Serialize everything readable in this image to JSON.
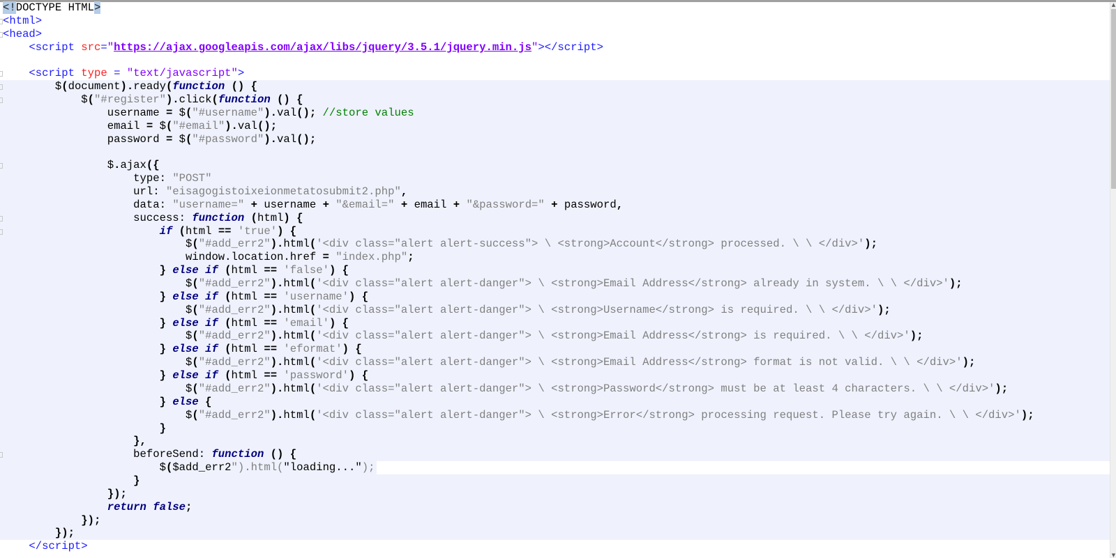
{
  "editor": {
    "lines": [
      {
        "bg": "",
        "fold": false,
        "tokens": [
          [
            "sel",
            "<!"
          ],
          [
            "d",
            "DOCTYPE HTML"
          ],
          [
            "sel",
            ">"
          ]
        ]
      },
      {
        "bg": "",
        "fold": true,
        "tokens": [
          [
            "t",
            "<html>"
          ]
        ]
      },
      {
        "bg": "",
        "fold": true,
        "tokens": [
          [
            "t",
            "<head>"
          ]
        ]
      },
      {
        "bg": "",
        "fold": false,
        "tokens": [
          [
            "t",
            "    <script "
          ],
          [
            "a",
            "src"
          ],
          [
            "t",
            "="
          ],
          [
            "s",
            "\""
          ],
          [
            "u",
            "https://ajax.googleapis.com/ajax/libs/jquery/3.5.1/jquery.min.js"
          ],
          [
            "s",
            "\""
          ],
          [
            "t",
            "></script>"
          ]
        ]
      },
      {
        "bg": "",
        "fold": false,
        "tokens": []
      },
      {
        "bg": "",
        "fold": true,
        "tokens": [
          [
            "t",
            "    <script "
          ],
          [
            "a",
            "type"
          ],
          [
            "t",
            " = "
          ],
          [
            "s",
            "\"text/javascript\""
          ],
          [
            "t",
            ">"
          ]
        ]
      },
      {
        "bg": "js",
        "fold": true,
        "tokens": [
          [
            "d",
            "        $"
          ],
          [
            "o",
            "("
          ],
          [
            "d",
            "document"
          ],
          [
            "o",
            ")."
          ],
          [
            "d",
            "ready"
          ],
          [
            "o",
            "("
          ],
          [
            "k",
            "function"
          ],
          [
            "o",
            " () {"
          ]
        ]
      },
      {
        "bg": "js",
        "fold": true,
        "tokens": [
          [
            "d",
            "            $"
          ],
          [
            "o",
            "("
          ],
          [
            "g",
            "\"#register\""
          ],
          [
            "o",
            ")."
          ],
          [
            "d",
            "click"
          ],
          [
            "o",
            "("
          ],
          [
            "k",
            "function"
          ],
          [
            "o",
            " () {"
          ]
        ]
      },
      {
        "bg": "js",
        "fold": false,
        "tokens": [
          [
            "d",
            "                username "
          ],
          [
            "o",
            "="
          ],
          [
            "d",
            " $"
          ],
          [
            "o",
            "("
          ],
          [
            "g",
            "\"#username\""
          ],
          [
            "o",
            ")."
          ],
          [
            "d",
            "val"
          ],
          [
            "o",
            "();"
          ],
          [
            "c",
            " //store values"
          ]
        ]
      },
      {
        "bg": "js",
        "fold": false,
        "tokens": [
          [
            "d",
            "                email "
          ],
          [
            "o",
            "="
          ],
          [
            "d",
            " $"
          ],
          [
            "o",
            "("
          ],
          [
            "g",
            "\"#email\""
          ],
          [
            "o",
            ")."
          ],
          [
            "d",
            "val"
          ],
          [
            "o",
            "();"
          ]
        ]
      },
      {
        "bg": "js",
        "fold": false,
        "tokens": [
          [
            "d",
            "                password "
          ],
          [
            "o",
            "="
          ],
          [
            "d",
            " $"
          ],
          [
            "o",
            "("
          ],
          [
            "g",
            "\"#password\""
          ],
          [
            "o",
            ")."
          ],
          [
            "d",
            "val"
          ],
          [
            "o",
            "();"
          ]
        ]
      },
      {
        "bg": "js",
        "fold": false,
        "tokens": []
      },
      {
        "bg": "js",
        "fold": true,
        "tokens": [
          [
            "d",
            "                $"
          ],
          [
            "o",
            "."
          ],
          [
            "d",
            "ajax"
          ],
          [
            "o",
            "({"
          ]
        ]
      },
      {
        "bg": "js",
        "fold": false,
        "tokens": [
          [
            "d",
            "                    type: "
          ],
          [
            "g",
            "\"POST\""
          ]
        ]
      },
      {
        "bg": "js",
        "fold": false,
        "tokens": [
          [
            "d",
            "                    url: "
          ],
          [
            "g",
            "\"eisagogistoixeionmetatosubmit2.php\""
          ],
          [
            "o",
            ","
          ]
        ]
      },
      {
        "bg": "js",
        "fold": false,
        "tokens": [
          [
            "d",
            "                    data: "
          ],
          [
            "g",
            "\"username=\""
          ],
          [
            "o",
            " + "
          ],
          [
            "d",
            "username "
          ],
          [
            "o",
            "+"
          ],
          [
            "d",
            " "
          ],
          [
            "g",
            "\"&email=\""
          ],
          [
            "o",
            " + "
          ],
          [
            "d",
            "email "
          ],
          [
            "o",
            "+"
          ],
          [
            "d",
            " "
          ],
          [
            "g",
            "\"&password=\""
          ],
          [
            "o",
            " + "
          ],
          [
            "d",
            "password"
          ],
          [
            "o",
            ","
          ]
        ]
      },
      {
        "bg": "js",
        "fold": true,
        "tokens": [
          [
            "d",
            "                    success: "
          ],
          [
            "k",
            "function"
          ],
          [
            "o",
            " ("
          ],
          [
            "d",
            "html"
          ],
          [
            "o",
            ") {"
          ]
        ]
      },
      {
        "bg": "js",
        "fold": true,
        "tokens": [
          [
            "d",
            "                        "
          ],
          [
            "k",
            "if"
          ],
          [
            "o",
            " ("
          ],
          [
            "d",
            "html "
          ],
          [
            "o",
            "=="
          ],
          [
            "d",
            " "
          ],
          [
            "g",
            "'true'"
          ],
          [
            "o",
            ") {"
          ]
        ]
      },
      {
        "bg": "js",
        "fold": false,
        "tokens": [
          [
            "d",
            "                            $"
          ],
          [
            "o",
            "("
          ],
          [
            "g",
            "\"#add_err2\""
          ],
          [
            "o",
            ")."
          ],
          [
            "d",
            "html"
          ],
          [
            "o",
            "("
          ],
          [
            "g",
            "'<div class=\"alert alert-success\"> \\ <strong>Account</strong> processed. \\ \\ </div>'"
          ],
          [
            "o",
            ");"
          ]
        ]
      },
      {
        "bg": "js",
        "fold": false,
        "tokens": [
          [
            "d",
            "                            window.location.href "
          ],
          [
            "o",
            "="
          ],
          [
            "d",
            " "
          ],
          [
            "g",
            "\"index.php\""
          ],
          [
            "o",
            ";"
          ]
        ]
      },
      {
        "bg": "js",
        "fold": false,
        "tokens": [
          [
            "o",
            "                        } "
          ],
          [
            "k",
            "else if"
          ],
          [
            "o",
            " ("
          ],
          [
            "d",
            "html "
          ],
          [
            "o",
            "=="
          ],
          [
            "d",
            " "
          ],
          [
            "g",
            "'false'"
          ],
          [
            "o",
            ") {"
          ]
        ]
      },
      {
        "bg": "js",
        "fold": false,
        "tokens": [
          [
            "d",
            "                            $"
          ],
          [
            "o",
            "("
          ],
          [
            "g",
            "\"#add_err2\""
          ],
          [
            "o",
            ")."
          ],
          [
            "d",
            "html"
          ],
          [
            "o",
            "("
          ],
          [
            "g",
            "'<div class=\"alert alert-danger\"> \\ <strong>Email Address</strong> already in system. \\ \\ </div>'"
          ],
          [
            "o",
            ");"
          ]
        ]
      },
      {
        "bg": "js",
        "fold": false,
        "tokens": [
          [
            "o",
            "                        } "
          ],
          [
            "k",
            "else if"
          ],
          [
            "o",
            " ("
          ],
          [
            "d",
            "html "
          ],
          [
            "o",
            "=="
          ],
          [
            "d",
            " "
          ],
          [
            "g",
            "'username'"
          ],
          [
            "o",
            ") {"
          ]
        ]
      },
      {
        "bg": "js",
        "fold": false,
        "tokens": [
          [
            "d",
            "                            $"
          ],
          [
            "o",
            "("
          ],
          [
            "g",
            "\"#add_err2\""
          ],
          [
            "o",
            ")."
          ],
          [
            "d",
            "html"
          ],
          [
            "o",
            "("
          ],
          [
            "g",
            "'<div class=\"alert alert-danger\"> \\ <strong>Username</strong> is required. \\ \\ </div>'"
          ],
          [
            "o",
            ");"
          ]
        ]
      },
      {
        "bg": "js",
        "fold": false,
        "tokens": [
          [
            "o",
            "                        } "
          ],
          [
            "k",
            "else if"
          ],
          [
            "o",
            " ("
          ],
          [
            "d",
            "html "
          ],
          [
            "o",
            "=="
          ],
          [
            "d",
            " "
          ],
          [
            "g",
            "'email'"
          ],
          [
            "o",
            ") {"
          ]
        ]
      },
      {
        "bg": "js",
        "fold": false,
        "tokens": [
          [
            "d",
            "                            $"
          ],
          [
            "o",
            "("
          ],
          [
            "g",
            "\"#add_err2\""
          ],
          [
            "o",
            ")."
          ],
          [
            "d",
            "html"
          ],
          [
            "o",
            "("
          ],
          [
            "g",
            "'<div class=\"alert alert-danger\"> \\ <strong>Email Address</strong> is required. \\ \\ </div>'"
          ],
          [
            "o",
            ");"
          ]
        ]
      },
      {
        "bg": "js",
        "fold": false,
        "tokens": [
          [
            "o",
            "                        } "
          ],
          [
            "k",
            "else if"
          ],
          [
            "o",
            " ("
          ],
          [
            "d",
            "html "
          ],
          [
            "o",
            "=="
          ],
          [
            "d",
            " "
          ],
          [
            "g",
            "'eformat'"
          ],
          [
            "o",
            ") {"
          ]
        ]
      },
      {
        "bg": "js",
        "fold": false,
        "tokens": [
          [
            "d",
            "                            $"
          ],
          [
            "o",
            "("
          ],
          [
            "g",
            "\"#add_err2\""
          ],
          [
            "o",
            ")."
          ],
          [
            "d",
            "html"
          ],
          [
            "o",
            "("
          ],
          [
            "g",
            "'<div class=\"alert alert-danger\"> \\ <strong>Email Address</strong> format is not valid. \\ \\ </div>'"
          ],
          [
            "o",
            ");"
          ]
        ]
      },
      {
        "bg": "js",
        "fold": false,
        "tokens": [
          [
            "o",
            "                        } "
          ],
          [
            "k",
            "else if"
          ],
          [
            "o",
            " ("
          ],
          [
            "d",
            "html "
          ],
          [
            "o",
            "=="
          ],
          [
            "d",
            " "
          ],
          [
            "g",
            "'password'"
          ],
          [
            "o",
            ") {"
          ]
        ]
      },
      {
        "bg": "js",
        "fold": false,
        "tokens": [
          [
            "d",
            "                            $"
          ],
          [
            "o",
            "("
          ],
          [
            "g",
            "\"#add_err2\""
          ],
          [
            "o",
            ")."
          ],
          [
            "d",
            "html"
          ],
          [
            "o",
            "("
          ],
          [
            "g",
            "'<div class=\"alert alert-danger\"> \\ <strong>Password</strong> must be at least 4 characters. \\ \\ </div>'"
          ],
          [
            "o",
            ");"
          ]
        ]
      },
      {
        "bg": "js",
        "fold": false,
        "tokens": [
          [
            "o",
            "                        } "
          ],
          [
            "k",
            "else"
          ],
          [
            "o",
            " {"
          ]
        ]
      },
      {
        "bg": "js",
        "fold": false,
        "tokens": [
          [
            "d",
            "                            $"
          ],
          [
            "o",
            "("
          ],
          [
            "g",
            "\"#add_err2\""
          ],
          [
            "o",
            ")."
          ],
          [
            "d",
            "html"
          ],
          [
            "o",
            "("
          ],
          [
            "g",
            "'<div class=\"alert alert-danger\"> \\ <strong>Error</strong> processing request. Please try again. \\ \\ </div>'"
          ],
          [
            "o",
            ");"
          ]
        ]
      },
      {
        "bg": "js",
        "fold": false,
        "tokens": [
          [
            "o",
            "                        }"
          ]
        ]
      },
      {
        "bg": "js",
        "fold": false,
        "tokens": [
          [
            "o",
            "                    },"
          ]
        ]
      },
      {
        "bg": "js",
        "fold": true,
        "tokens": [
          [
            "d",
            "                    beforeSend: "
          ],
          [
            "k",
            "function"
          ],
          [
            "o",
            " () {"
          ]
        ]
      },
      {
        "bg": "cur",
        "fold": false,
        "tokens": [
          [
            "d",
            "                        $"
          ],
          [
            "o",
            "("
          ],
          [
            "d",
            "$add_err2"
          ],
          [
            "g",
            "\").html("
          ],
          [
            "d",
            "\"loading...\""
          ],
          [
            "g",
            ");"
          ]
        ]
      },
      {
        "bg": "js",
        "fold": false,
        "tokens": [
          [
            "o",
            "                    }"
          ]
        ]
      },
      {
        "bg": "js",
        "fold": false,
        "tokens": [
          [
            "o",
            "                });"
          ]
        ]
      },
      {
        "bg": "js",
        "fold": false,
        "tokens": [
          [
            "d",
            "                "
          ],
          [
            "k",
            "return false"
          ],
          [
            "o",
            ";"
          ]
        ]
      },
      {
        "bg": "js",
        "fold": false,
        "tokens": [
          [
            "o",
            "            });"
          ]
        ]
      },
      {
        "bg": "js",
        "fold": false,
        "tokens": [
          [
            "o",
            "        });"
          ]
        ]
      },
      {
        "bg": "",
        "fold": false,
        "tokens": [
          [
            "t",
            "    </script>"
          ]
        ]
      }
    ]
  },
  "scrollbar": {
    "position_fraction": 0.0,
    "visible_fraction": 0.33
  }
}
